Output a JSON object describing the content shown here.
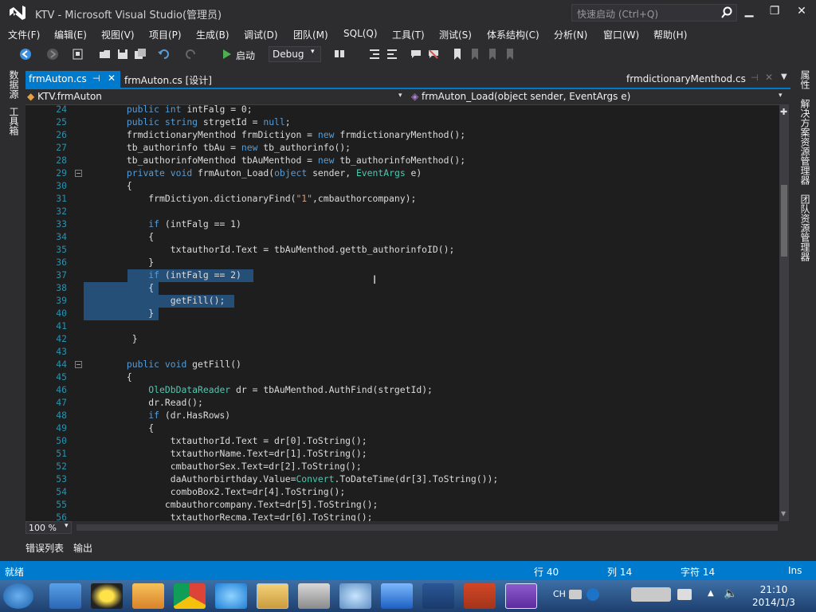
{
  "title": "KTV - Microsoft Visual Studio(管理员)",
  "quick_launch": "快速启动 (Ctrl+Q)",
  "menu": [
    "文件(F)",
    "编辑(E)",
    "视图(V)",
    "项目(P)",
    "生成(B)",
    "调试(D)",
    "团队(M)",
    "SQL(Q)",
    "工具(T)",
    "测试(S)",
    "体系结构(C)",
    "分析(N)",
    "窗口(W)",
    "帮助(H)"
  ],
  "toolbar": {
    "start": "启动",
    "config": "Debug"
  },
  "left_panel": [
    "数据源",
    "工具箱"
  ],
  "right_panel": [
    "属性",
    "解决方案资源管理器",
    "团队资源管理器"
  ],
  "tabs": {
    "active": "frmAuton.cs",
    "second": "frmAuton.cs [设计]",
    "right": "frmdictionaryMenthod.cs"
  },
  "nav": {
    "left": "KTV.frmAuton",
    "right": "frmAuton_Load(object sender, EventArgs e)"
  },
  "code_lines": [
    {
      "n": "24",
      "t": "public int intFalg = 0;"
    },
    {
      "n": "25",
      "t": "public string strgetId = null;"
    },
    {
      "n": "26",
      "t": "frmdictionaryMenthod frmDictiyon = new frmdictionaryMenthod();"
    },
    {
      "n": "27",
      "t": "tb_authorinfo tbAu = new tb_authorinfo();"
    },
    {
      "n": "28",
      "t": "tb_authorinfoMenthod tbAuMenthod = new tb_authorinfoMenthod();"
    },
    {
      "n": "29",
      "t": "private void frmAuton_Load(object sender, EventArgs e)"
    },
    {
      "n": "30",
      "t": "{"
    },
    {
      "n": "31",
      "t": "    frmDictiyon.dictionaryFind(\"1\",cmbauthorcompany);"
    },
    {
      "n": "32",
      "t": ""
    },
    {
      "n": "33",
      "t": "    if (intFalg == 1)"
    },
    {
      "n": "34",
      "t": "    {"
    },
    {
      "n": "35",
      "t": "        txtauthorId.Text = tbAuMenthod.gettb_authorinfoID();"
    },
    {
      "n": "36",
      "t": "    }"
    },
    {
      "n": "37",
      "t": "    if (intFalg == 2)"
    },
    {
      "n": "38",
      "t": "    {"
    },
    {
      "n": "39",
      "t": "        getFill();"
    },
    {
      "n": "40",
      "t": "    }"
    },
    {
      "n": "41",
      "t": ""
    },
    {
      "n": "42",
      "t": " }"
    },
    {
      "n": "43",
      "t": ""
    },
    {
      "n": "44",
      "t": "public void getFill()"
    },
    {
      "n": "45",
      "t": "{"
    },
    {
      "n": "46",
      "t": "    OleDbDataReader dr = tbAuMenthod.AuthFind(strgetId);"
    },
    {
      "n": "47",
      "t": "    dr.Read();"
    },
    {
      "n": "48",
      "t": "    if (dr.HasRows)"
    },
    {
      "n": "49",
      "t": "    {"
    },
    {
      "n": "50",
      "t": "        txtauthorId.Text = dr[0].ToString();"
    },
    {
      "n": "51",
      "t": "        txtauthorName.Text=dr[1].ToString();"
    },
    {
      "n": "52",
      "t": "        cmbauthorSex.Text=dr[2].ToString();"
    },
    {
      "n": "53",
      "t": "        daAuthorbirthday.Value=Convert.ToDateTime(dr[3].ToString());"
    },
    {
      "n": "54",
      "t": "        comboBox2.Text=dr[4].ToString();"
    },
    {
      "n": "55",
      "t": "       cmbauthorcompany.Text=dr[5].ToString();"
    },
    {
      "n": "56",
      "t": "        txtauthorRecma.Text=dr[6].ToString();"
    }
  ],
  "zoom": "100 %",
  "bottom_tabs": [
    "错误列表",
    "输出"
  ],
  "status": {
    "ready": "就绪",
    "line": "行 40",
    "col": "列 14",
    "char": "字符 14",
    "mode": "Ins"
  },
  "tray": {
    "ime": "CH",
    "time": "21:10",
    "date": "2014/1/3"
  }
}
